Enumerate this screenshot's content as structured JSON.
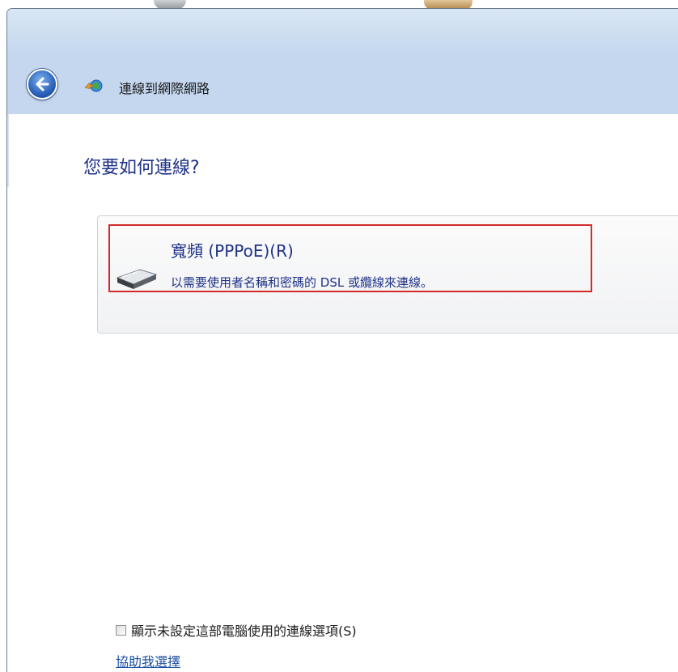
{
  "window": {
    "title": "連線到網際網路"
  },
  "navigation": {
    "back_icon": "back-arrow-icon",
    "wizard_icon": "network-globe-icon"
  },
  "main": {
    "heading": "您要如何連線?",
    "options": [
      {
        "title": "寬頻 (PPPoE)(R)",
        "description": "以需要使用者名稱和密碼的 DSL 或纜線來連線。",
        "icon": "modem-icon",
        "highlighted": true
      }
    ],
    "show_unconfigured_checkbox": {
      "label": "顯示未設定這部電腦使用的連線選項(S)",
      "checked": false
    },
    "help_link": "協助我選擇"
  },
  "colors": {
    "heading_text": "#1e3287",
    "link_text": "#1a4fa3",
    "highlight_border": "#d42a2a",
    "navbar_bg": "#c4d7ef"
  }
}
